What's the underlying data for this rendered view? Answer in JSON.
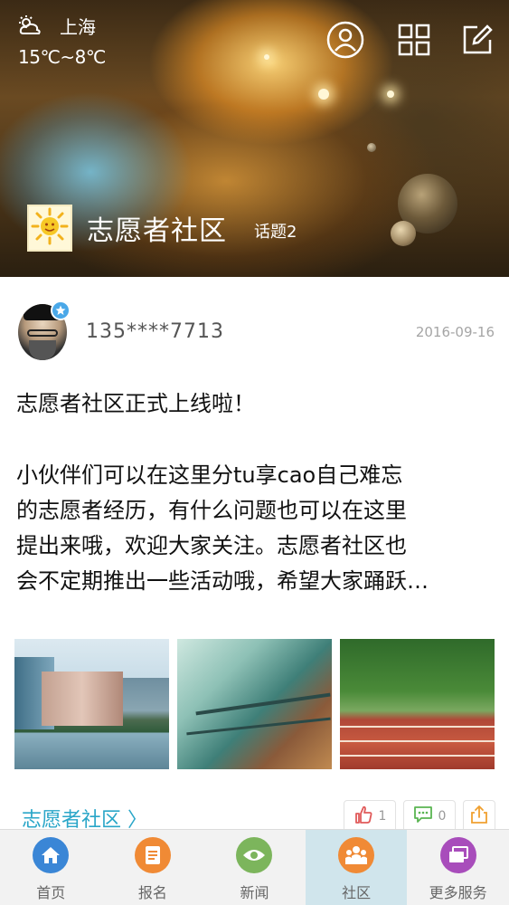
{
  "header": {
    "weather": {
      "icon": "cloudy-sun-icon",
      "city": "上海",
      "temperature": "15℃~8℃"
    },
    "community": {
      "name": "志愿者社区",
      "topics": "话题2"
    }
  },
  "post": {
    "author": "135****7713",
    "date": "2016-09-16",
    "title": "志愿者社区正式上线啦！",
    "body_lines": [
      "小伙伴们可以在这里分tu享cao自己难忘",
      "的志愿者经历，有什么问题也可以在这里",
      "提出来哦，欢迎大家关注。志愿者社区也",
      "会不定期推出一些活动哦，希望大家踊跃…"
    ],
    "community_link": "志愿者社区 〉",
    "likes": "1",
    "comments": "0"
  },
  "nav": {
    "items": [
      {
        "label": "首页",
        "color": "#3a86d6",
        "icon": "home-icon"
      },
      {
        "label": "报名",
        "color": "#f08a35",
        "icon": "document-icon"
      },
      {
        "label": "新闻",
        "color": "#7cb55c",
        "icon": "eye-icon"
      },
      {
        "label": "社区",
        "color": "#f08a35",
        "icon": "people-icon"
      },
      {
        "label": "更多服务",
        "color": "#a84dbb",
        "icon": "cards-icon"
      }
    ],
    "active": "社区"
  },
  "colors": {
    "accent": "#2aa6c8",
    "like": "#e05a5a",
    "comment": "#5ab552",
    "share": "#f0a030"
  }
}
